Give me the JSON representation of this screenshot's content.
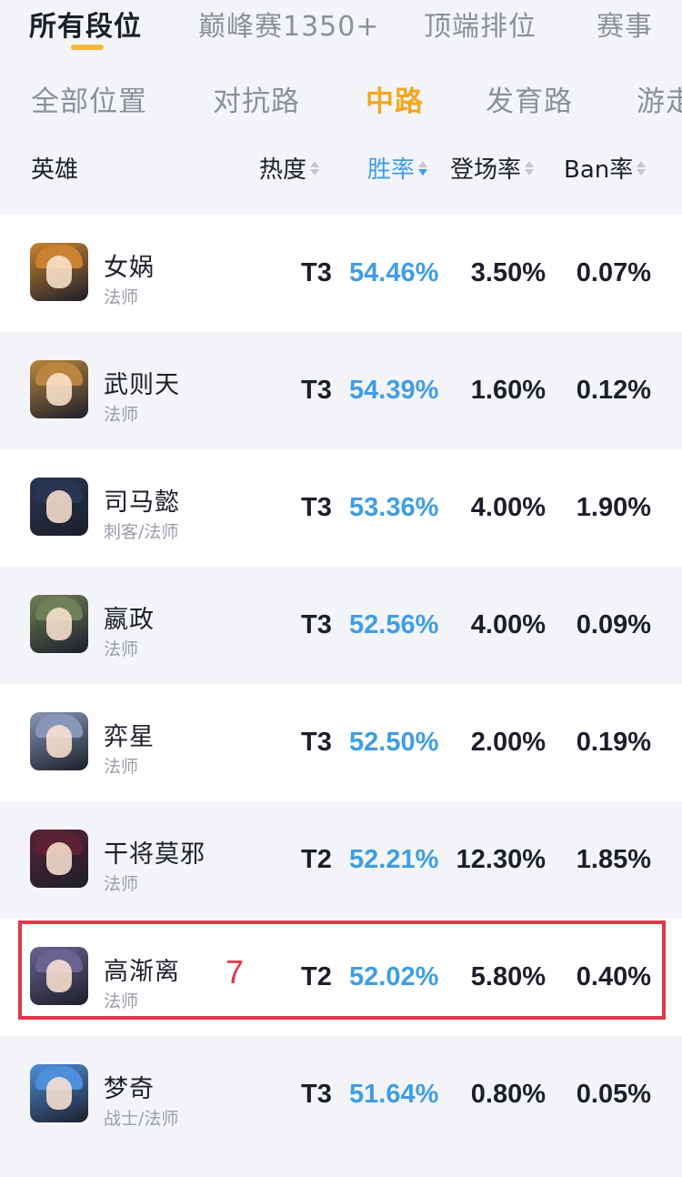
{
  "top_tabs": [
    "所有段位",
    "巅峰赛1350+",
    "顶端排位",
    "赛事"
  ],
  "lane_tabs": [
    "全部位置",
    "对抗路",
    "中路",
    "发育路",
    "游走"
  ],
  "columns": {
    "hero": "英雄",
    "heat": "热度",
    "win": "胜率",
    "pick": "登场率",
    "ban": "Ban率"
  },
  "heroes": [
    {
      "name": "女娲",
      "role": "法师",
      "tier": "T3",
      "win": "54.46%",
      "pick": "3.50%",
      "ban": "0.07%",
      "avatar_color": "#c9822f"
    },
    {
      "name": "武则天",
      "role": "法师",
      "tier": "T3",
      "win": "54.39%",
      "pick": "1.60%",
      "ban": "0.12%",
      "avatar_color": "#b8863e"
    },
    {
      "name": "司马懿",
      "role": "刺客/法师",
      "tier": "T3",
      "win": "53.36%",
      "pick": "4.00%",
      "ban": "1.90%",
      "avatar_color": "#2a3552"
    },
    {
      "name": "嬴政",
      "role": "法师",
      "tier": "T3",
      "win": "52.56%",
      "pick": "4.00%",
      "ban": "0.09%",
      "avatar_color": "#6f7f58"
    },
    {
      "name": "弈星",
      "role": "法师",
      "tier": "T3",
      "win": "52.50%",
      "pick": "2.00%",
      "ban": "0.19%",
      "avatar_color": "#8896b8"
    },
    {
      "name": "干将莫邪",
      "role": "法师",
      "tier": "T2",
      "win": "52.21%",
      "pick": "12.30%",
      "ban": "1.85%",
      "avatar_color": "#5a2234"
    },
    {
      "name": "高渐离",
      "role": "法师",
      "tier": "T2",
      "win": "52.02%",
      "pick": "5.80%",
      "ban": "0.40%",
      "avatar_color": "#6b6291"
    },
    {
      "name": "梦奇",
      "role": "战士/法师",
      "tier": "T3",
      "win": "51.64%",
      "pick": "0.80%",
      "ban": "0.05%",
      "avatar_color": "#4d8fd8"
    }
  ],
  "annotation": "7",
  "colors": {
    "accent": "#f3a71f",
    "win_rate": "#3e9de6",
    "highlight": "#e0384a"
  }
}
